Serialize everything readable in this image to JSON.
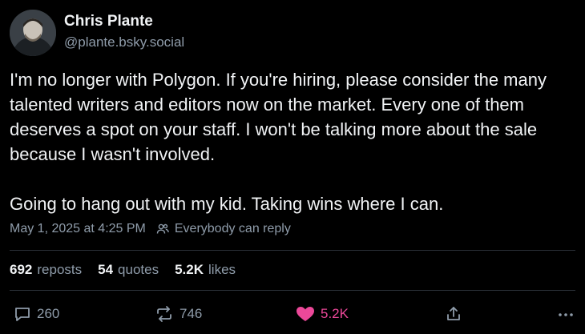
{
  "author": {
    "display_name": "Chris Plante",
    "handle": "@plante.bsky.social"
  },
  "post": {
    "paragraphs": [
      "I'm no longer with Polygon. If you're hiring, please consider the many talented writers and editors now on the market. Every one of them deserves a spot on your staff. I won't be talking more about the sale because I wasn't involved.",
      "Going to hang out with my kid. Taking wins where I can."
    ],
    "timestamp": "May 1, 2025 at 4:25 PM",
    "reply_setting": "Everybody can reply"
  },
  "stats": {
    "reposts_count": "692",
    "reposts_label": "reposts",
    "quotes_count": "54",
    "quotes_label": "quotes",
    "likes_count": "5.2K",
    "likes_label": "likes"
  },
  "actions": {
    "reply_count": "260",
    "repost_count": "746",
    "like_count": "5.2K"
  },
  "icons": {
    "reply": "reply-bubble-icon",
    "repost": "repost-arrows-icon",
    "like": "heart-icon",
    "share": "share-icon",
    "more": "more-dots-icon",
    "audience": "people-icon"
  },
  "colors": {
    "background": "#000000",
    "text": "#f1f3f5",
    "muted": "#8f9caa",
    "like_accent": "#ec4899",
    "divider": "#2a3038"
  }
}
